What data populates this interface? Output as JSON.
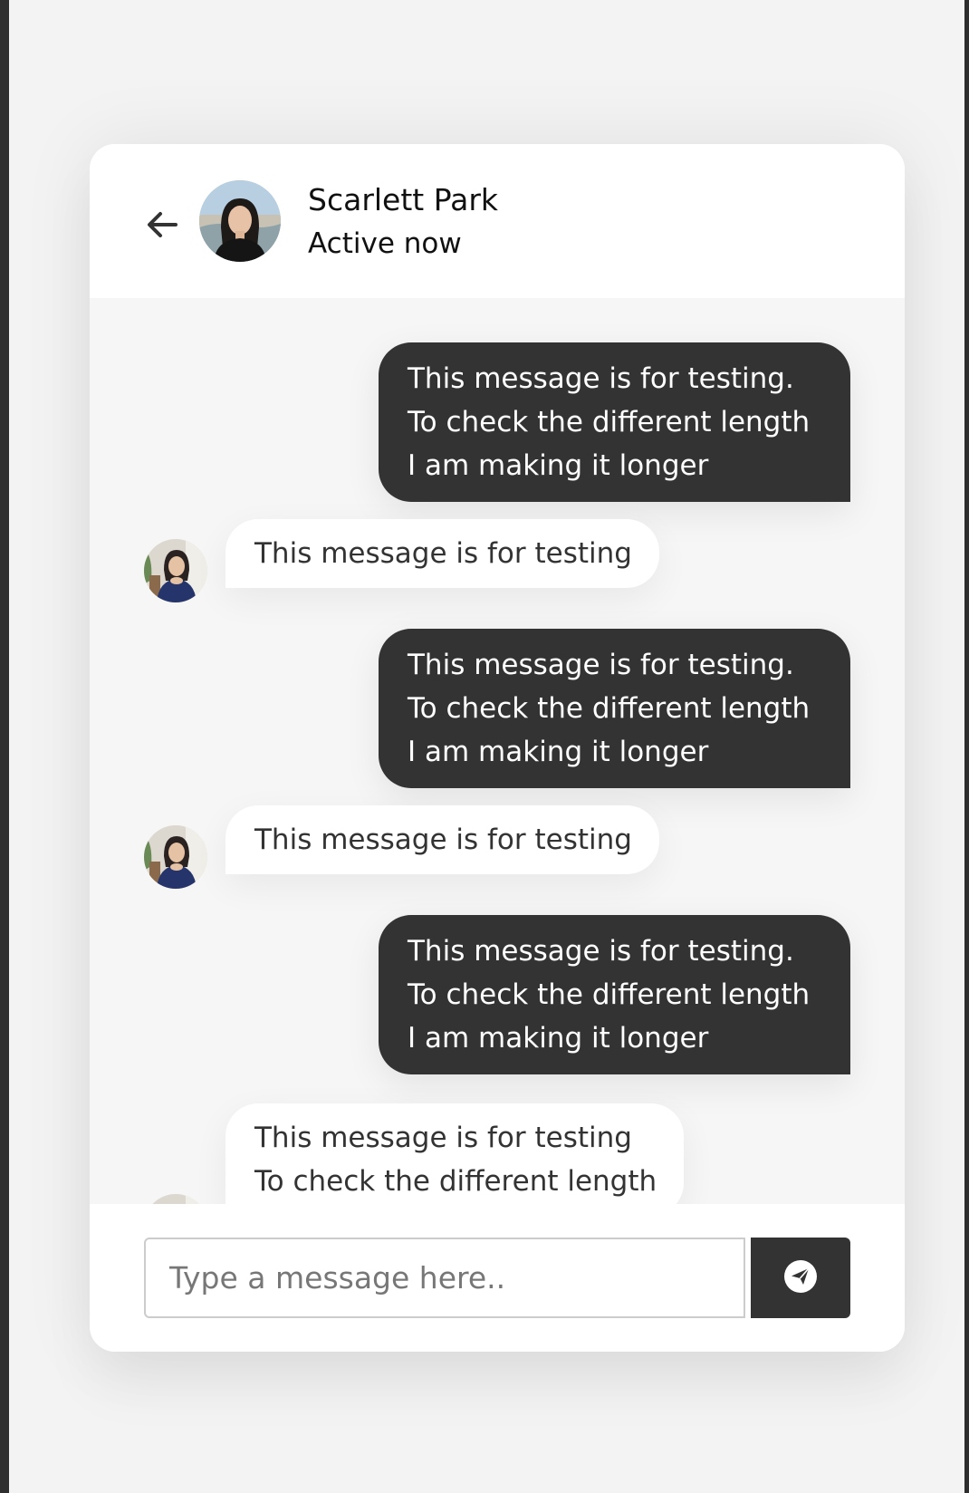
{
  "header": {
    "back_icon": "arrow-left-icon",
    "avatar_alt": "Scarlett Park avatar",
    "name": "Scarlett Park",
    "status": "Active now"
  },
  "messages": [
    {
      "direction": "outgoing",
      "lines": [
        "This message is for testing.",
        "To check the different length",
        "I am making it longer"
      ]
    },
    {
      "direction": "incoming",
      "lines": [
        "This message is for testing"
      ]
    },
    {
      "direction": "outgoing",
      "lines": [
        "This message is for testing.",
        "To check the different length",
        "I am making it longer"
      ]
    },
    {
      "direction": "incoming",
      "lines": [
        "This message is for testing"
      ]
    },
    {
      "direction": "outgoing",
      "lines": [
        "This message is for testing.",
        "To check the different length",
        "I am making it longer"
      ]
    },
    {
      "direction": "incoming",
      "lines": [
        "This message is for testing",
        "To check the different length"
      ]
    }
  ],
  "composer": {
    "placeholder": "Type a message here..",
    "value": "",
    "send_icon": "paper-plane-icon"
  },
  "colors": {
    "outgoing_bubble": "#333333",
    "incoming_bubble": "#ffffff",
    "chat_background": "#f6f6f6",
    "send_button": "#333333"
  }
}
